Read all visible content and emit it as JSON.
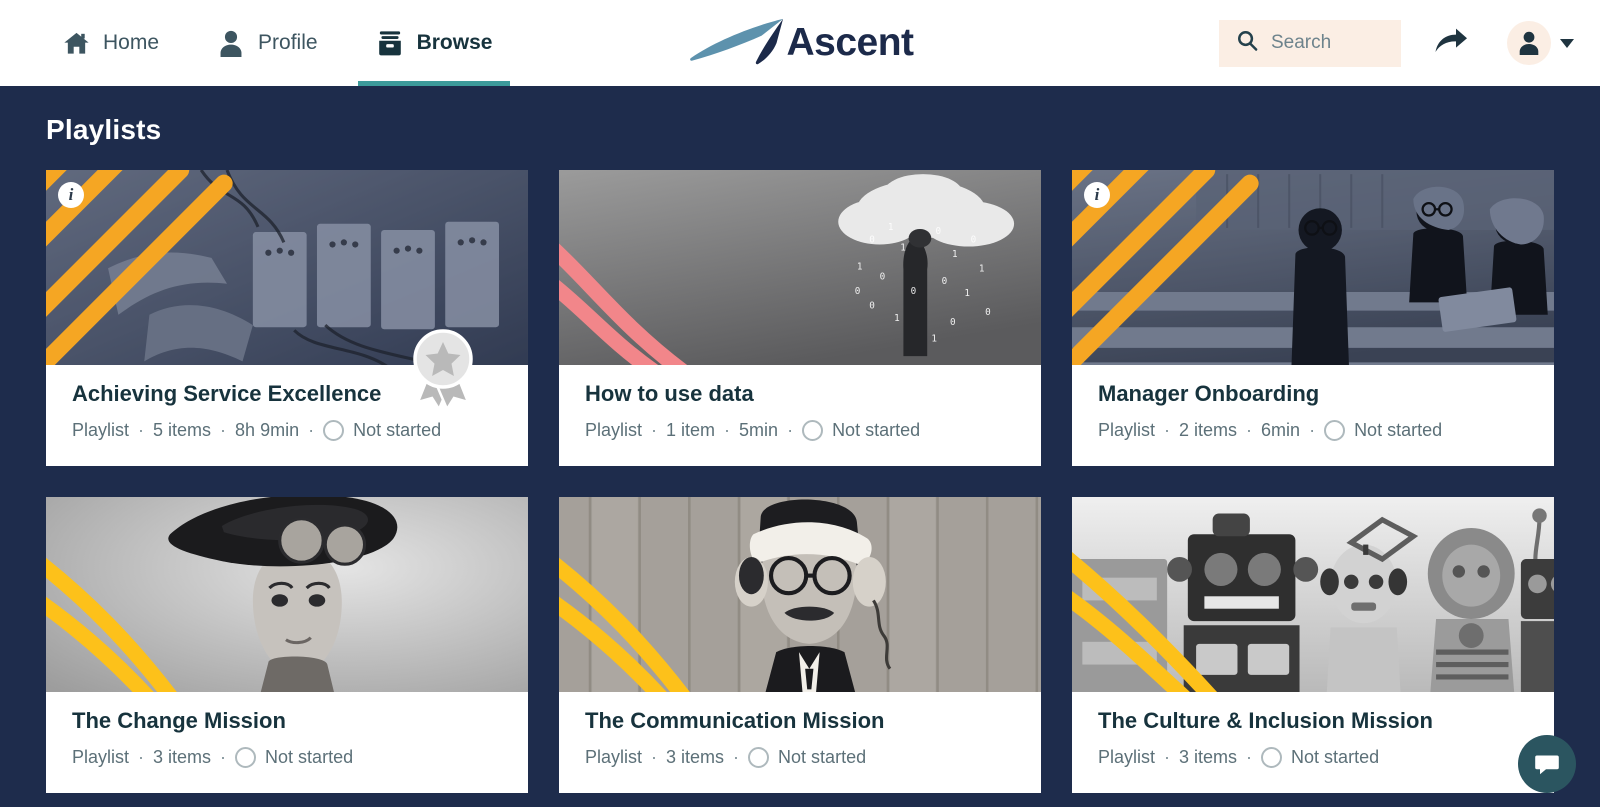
{
  "header": {
    "nav": [
      {
        "label": "Home",
        "icon": "home-icon",
        "active": false
      },
      {
        "label": "Profile",
        "icon": "person-icon",
        "active": false
      },
      {
        "label": "Browse",
        "icon": "box-icon",
        "active": true
      }
    ],
    "logo_text": "Ascent",
    "logo_icon": "ascent-swoosh-icon",
    "search": {
      "placeholder": "Search",
      "value": "",
      "icon": "search-icon",
      "background": "#fbeee4"
    },
    "share_icon": "share-arrow-icon",
    "avatar_icon": "person-icon",
    "avatar_caret_icon": "chevron-down-icon",
    "active_tab_underline_color": "#3d9b9b"
  },
  "page": {
    "title": "Playlists",
    "background": "#1e2c4c"
  },
  "cards": [
    {
      "title": "Achieving Service Excellence",
      "type": "Playlist",
      "items": "5 items",
      "duration": "8h 9min",
      "status": "Not started",
      "has_info_badge": true,
      "has_award_badge": true,
      "stripe_color": "#f5a623",
      "stripe_style": "diagonal",
      "tint": "blue",
      "image_alt": "hands wiring an electrical panel"
    },
    {
      "title": "How to use data",
      "type": "Playlist",
      "items": "1 item",
      "duration": "5min",
      "status": "Not started",
      "has_info_badge": false,
      "has_award_badge": false,
      "stripe_color": "#f2868a",
      "stripe_style": "curve",
      "tint": "gray",
      "image_alt": "person with cloud of binary digits for a head"
    },
    {
      "title": "Manager Onboarding",
      "type": "Playlist",
      "items": "2 items",
      "duration": "6min",
      "status": "Not started",
      "has_info_badge": true,
      "has_award_badge": false,
      "stripe_color": "#f5a623",
      "stripe_style": "diagonal",
      "tint": "blue",
      "image_alt": "three students talking on outdoor steps"
    },
    {
      "title": "The Change Mission",
      "type": "Playlist",
      "items": "3 items",
      "duration": "",
      "status": "Not started",
      "has_info_badge": false,
      "has_award_badge": false,
      "stripe_color": "#fdc11a",
      "stripe_style": "curve",
      "tint": "gray",
      "image_alt": "woman wearing hat and goggles looking up"
    },
    {
      "title": "The Communication Mission",
      "type": "Playlist",
      "items": "3 items",
      "duration": "",
      "status": "Not started",
      "has_info_badge": false,
      "has_award_badge": false,
      "stripe_color": "#fdc11a",
      "stripe_style": "curve",
      "tint": "gray",
      "image_alt": "man with telephone handsets strapped to his head"
    },
    {
      "title": "The Culture & Inclusion Mission",
      "type": "Playlist",
      "items": "3 items",
      "duration": "",
      "status": "Not started",
      "has_info_badge": false,
      "has_award_badge": false,
      "stripe_color": "#fdc11a",
      "stripe_style": "curve",
      "tint": "gray",
      "image_alt": "row of vintage toy robots"
    }
  ],
  "chat": {
    "icon": "chat-bubble-icon",
    "color": "#2b5560"
  },
  "separator": "·"
}
